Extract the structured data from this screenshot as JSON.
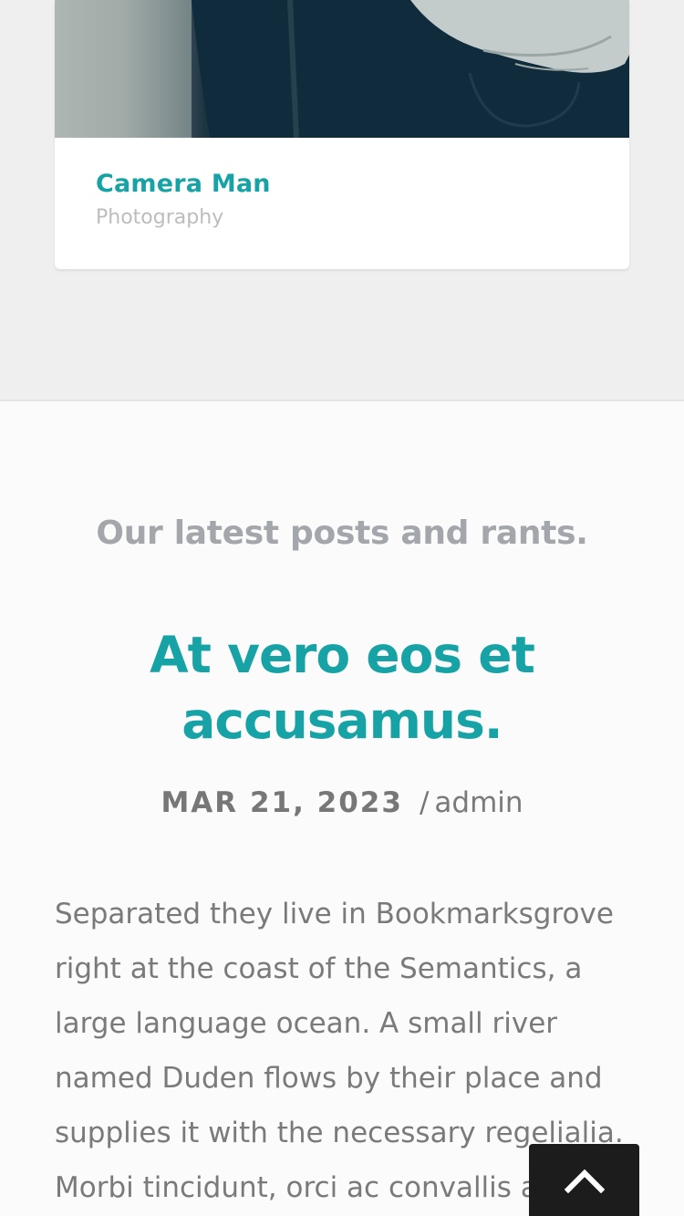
{
  "portfolio": {
    "card_title": "Camera Man",
    "card_category": "Photography"
  },
  "blog": {
    "section_heading": "Our latest posts and rants.",
    "post": {
      "title": "At vero eos et accusamus.",
      "date": "MAR 21, 2023",
      "separator": "/",
      "author": "admin",
      "excerpt": "Separated they live in Bookmarksgrove right at the coast of the Semantics, a large language ocean. A small river named Duden flows by their place and supplies it with the necessary regelialia. Morbi tincidunt, orci ac convallis aliquam"
    }
  },
  "icons": {
    "back_to_top": "chevron-up-icon"
  },
  "colors": {
    "accent": "#17a3a5",
    "heading_gray": "#a3a7ab",
    "text_gray": "#7a7a7a",
    "button_dark": "#1c1c1c"
  }
}
